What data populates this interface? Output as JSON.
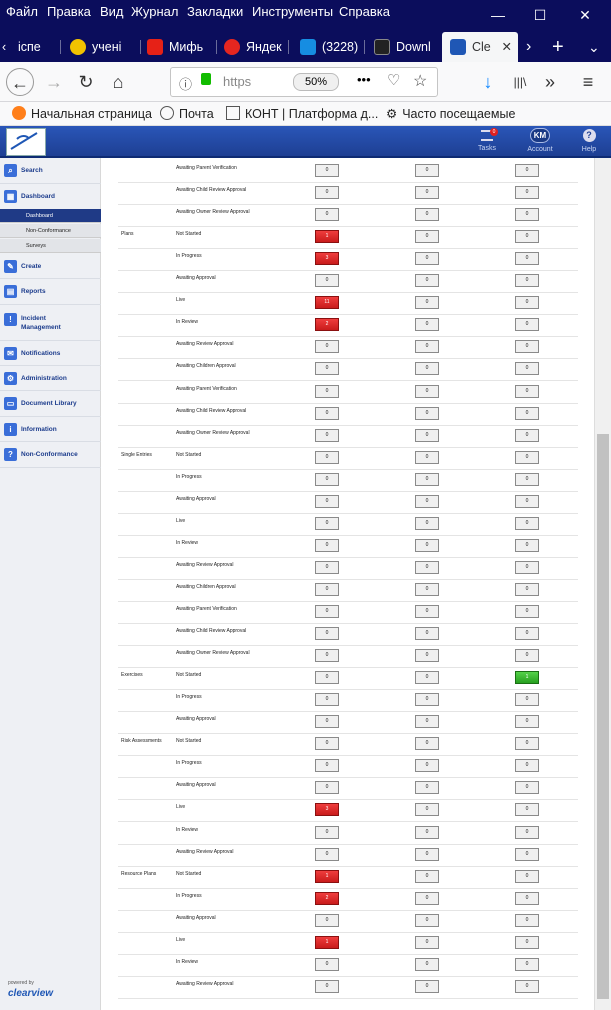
{
  "menubar": {
    "items": [
      "Файл",
      "Правка",
      "Вид",
      "Журнал",
      "Закладки",
      "Инструменты",
      "Справка"
    ],
    "minimize": "—",
    "maximize": "☐",
    "close": "✕"
  },
  "tabs": [
    {
      "label": "іспе",
      "icon": "green-icon",
      "color": "#2b7a2b"
    },
    {
      "label": "учені",
      "icon": "yandex-play-icon",
      "color": "#f2c200"
    },
    {
      "label": "Мифь",
      "icon": "youtube-icon",
      "color": "#e62117"
    },
    {
      "label": "Яндек",
      "icon": "yandex-a-icon",
      "color": "#e52620"
    },
    {
      "label": "(3228)",
      "icon": "mail-at-icon",
      "color": "#168de2"
    },
    {
      "label": "Downl",
      "icon": "dot-icon",
      "color": "#222222"
    },
    {
      "label": "Cle",
      "icon": "clearview-icon",
      "color": "#1f57b5"
    }
  ],
  "tab_close": "✕",
  "new_tab": "+",
  "tab_scroll": "›",
  "tabs_dropdown": "⌄",
  "navbar": {
    "back": "←",
    "forward": "→",
    "reload": "↻",
    "home": "⌂",
    "url": "https",
    "zoom": "50%",
    "more": "•••",
    "download": "↓",
    "library": "|||\\",
    "overflow": "»",
    "menu": "≡"
  },
  "bookmarks": [
    {
      "label": "Начальная страница",
      "icon": "firefox-icon"
    },
    {
      "label": "Почта",
      "icon": "globe-icon"
    },
    {
      "label": "КОНТ | Платформа д...",
      "icon": "kont-icon"
    },
    {
      "label": "Часто посещаемые",
      "icon": "gear-icon"
    }
  ],
  "header": {
    "tasks_label": "Tasks",
    "tasks_badge": "0",
    "account_initials": "KM",
    "account_label": "Account",
    "help_label": "Help",
    "help_glyph": "?"
  },
  "sidebar": {
    "items": [
      {
        "label": "Search",
        "icon": "search-icon",
        "glyph": "⌕"
      },
      {
        "label": "Dashboard",
        "icon": "dashboard-icon",
        "glyph": "▦"
      },
      {
        "label": "Create",
        "icon": "create-icon",
        "glyph": "✎"
      },
      {
        "label": "Reports",
        "icon": "reports-icon",
        "glyph": "▤"
      },
      {
        "label": "Incident Management",
        "icon": "incident-icon",
        "glyph": "!"
      },
      {
        "label": "Notifications",
        "icon": "mail-icon",
        "glyph": "✉"
      },
      {
        "label": "Administration",
        "icon": "admin-icon",
        "glyph": "⚙"
      },
      {
        "label": "Document Library",
        "icon": "library-icon",
        "glyph": "▭"
      },
      {
        "label": "Information",
        "icon": "info-icon",
        "glyph": "i"
      },
      {
        "label": "Non-Conformance",
        "icon": "help-icon",
        "glyph": "?"
      }
    ],
    "subitems": [
      "Dashboard",
      "Non-Conformance",
      "Surveys"
    ],
    "powered_by": "powered by",
    "brand": "clearview"
  },
  "rows": [
    {
      "cat": "",
      "status": "Awaiting Parent Verification",
      "c": [
        "0",
        "0",
        "0"
      ],
      "s": [
        "",
        "",
        ""
      ]
    },
    {
      "cat": "",
      "status": "Awaiting Child Review Approval",
      "c": [
        "0",
        "0",
        "0"
      ],
      "s": [
        "",
        "",
        ""
      ]
    },
    {
      "cat": "",
      "status": "Awaiting Owner Review Approval",
      "c": [
        "0",
        "0",
        "0"
      ],
      "s": [
        "",
        "",
        ""
      ]
    },
    {
      "cat": "Plans",
      "status": "Not Started",
      "c": [
        "1",
        "0",
        "0"
      ],
      "s": [
        "red",
        "",
        ""
      ]
    },
    {
      "cat": "",
      "status": "In Progress",
      "c": [
        "3",
        "0",
        "0"
      ],
      "s": [
        "red",
        "",
        ""
      ]
    },
    {
      "cat": "",
      "status": "Awaiting Approval",
      "c": [
        "0",
        "0",
        "0"
      ],
      "s": [
        "",
        "",
        ""
      ]
    },
    {
      "cat": "",
      "status": "Live",
      "c": [
        "11",
        "0",
        "0"
      ],
      "s": [
        "red",
        "",
        ""
      ]
    },
    {
      "cat": "",
      "status": "In Review",
      "c": [
        "2",
        "0",
        "0"
      ],
      "s": [
        "red",
        "",
        ""
      ]
    },
    {
      "cat": "",
      "status": "Awaiting Review Approval",
      "c": [
        "0",
        "0",
        "0"
      ],
      "s": [
        "",
        "",
        ""
      ]
    },
    {
      "cat": "",
      "status": "Awaiting Children Approval",
      "c": [
        "0",
        "0",
        "0"
      ],
      "s": [
        "",
        "",
        ""
      ]
    },
    {
      "cat": "",
      "status": "Awaiting Parent Verification",
      "c": [
        "0",
        "0",
        "0"
      ],
      "s": [
        "",
        "",
        ""
      ]
    },
    {
      "cat": "",
      "status": "Awaiting Child Review Approval",
      "c": [
        "0",
        "0",
        "0"
      ],
      "s": [
        "",
        "",
        ""
      ]
    },
    {
      "cat": "",
      "status": "Awaiting Owner Review Approval",
      "c": [
        "0",
        "0",
        "0"
      ],
      "s": [
        "",
        "",
        ""
      ]
    },
    {
      "cat": "Single Entries",
      "status": "Not Started",
      "c": [
        "0",
        "0",
        "0"
      ],
      "s": [
        "",
        "",
        ""
      ]
    },
    {
      "cat": "",
      "status": "In Progress",
      "c": [
        "0",
        "0",
        "0"
      ],
      "s": [
        "",
        "",
        ""
      ]
    },
    {
      "cat": "",
      "status": "Awaiting Approval",
      "c": [
        "0",
        "0",
        "0"
      ],
      "s": [
        "",
        "",
        ""
      ]
    },
    {
      "cat": "",
      "status": "Live",
      "c": [
        "0",
        "0",
        "0"
      ],
      "s": [
        "",
        "",
        ""
      ]
    },
    {
      "cat": "",
      "status": "In Review",
      "c": [
        "0",
        "0",
        "0"
      ],
      "s": [
        "",
        "",
        ""
      ]
    },
    {
      "cat": "",
      "status": "Awaiting Review Approval",
      "c": [
        "0",
        "0",
        "0"
      ],
      "s": [
        "",
        "",
        ""
      ]
    },
    {
      "cat": "",
      "status": "Awaiting Children Approval",
      "c": [
        "0",
        "0",
        "0"
      ],
      "s": [
        "",
        "",
        ""
      ]
    },
    {
      "cat": "",
      "status": "Awaiting Parent Verification",
      "c": [
        "0",
        "0",
        "0"
      ],
      "s": [
        "",
        "",
        ""
      ]
    },
    {
      "cat": "",
      "status": "Awaiting Child Review Approval",
      "c": [
        "0",
        "0",
        "0"
      ],
      "s": [
        "",
        "",
        ""
      ]
    },
    {
      "cat": "",
      "status": "Awaiting Owner Review Approval",
      "c": [
        "0",
        "0",
        "0"
      ],
      "s": [
        "",
        "",
        ""
      ]
    },
    {
      "cat": "Exercises",
      "status": "Not Started",
      "c": [
        "0",
        "0",
        "1"
      ],
      "s": [
        "",
        "",
        "green"
      ]
    },
    {
      "cat": "",
      "status": "In Progress",
      "c": [
        "0",
        "0",
        "0"
      ],
      "s": [
        "",
        "",
        ""
      ]
    },
    {
      "cat": "",
      "status": "Awaiting Approval",
      "c": [
        "0",
        "0",
        "0"
      ],
      "s": [
        "",
        "",
        ""
      ]
    },
    {
      "cat": "Risk Assessments",
      "status": "Not Started",
      "c": [
        "0",
        "0",
        "0"
      ],
      "s": [
        "",
        "",
        ""
      ]
    },
    {
      "cat": "",
      "status": "In Progress",
      "c": [
        "0",
        "0",
        "0"
      ],
      "s": [
        "",
        "",
        ""
      ]
    },
    {
      "cat": "",
      "status": "Awaiting Approval",
      "c": [
        "0",
        "0",
        "0"
      ],
      "s": [
        "",
        "",
        ""
      ]
    },
    {
      "cat": "",
      "status": "Live",
      "c": [
        "3",
        "0",
        "0"
      ],
      "s": [
        "red",
        "",
        ""
      ]
    },
    {
      "cat": "",
      "status": "In Review",
      "c": [
        "0",
        "0",
        "0"
      ],
      "s": [
        "",
        "",
        ""
      ]
    },
    {
      "cat": "",
      "status": "Awaiting Review Approval",
      "c": [
        "0",
        "0",
        "0"
      ],
      "s": [
        "",
        "",
        ""
      ]
    },
    {
      "cat": "Resource Plans",
      "status": "Not Started",
      "c": [
        "1",
        "0",
        "0"
      ],
      "s": [
        "red",
        "",
        ""
      ]
    },
    {
      "cat": "",
      "status": "In Progress",
      "c": [
        "2",
        "0",
        "0"
      ],
      "s": [
        "red",
        "",
        ""
      ]
    },
    {
      "cat": "",
      "status": "Awaiting Approval",
      "c": [
        "0",
        "0",
        "0"
      ],
      "s": [
        "",
        "",
        ""
      ]
    },
    {
      "cat": "",
      "status": "Live",
      "c": [
        "1",
        "0",
        "0"
      ],
      "s": [
        "red",
        "",
        ""
      ]
    },
    {
      "cat": "",
      "status": "In Review",
      "c": [
        "0",
        "0",
        "0"
      ],
      "s": [
        "",
        "",
        ""
      ]
    },
    {
      "cat": "",
      "status": "Awaiting Review Approval",
      "c": [
        "0",
        "0",
        "0"
      ],
      "s": [
        "",
        "",
        ""
      ]
    }
  ]
}
